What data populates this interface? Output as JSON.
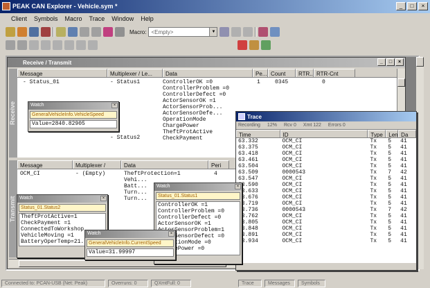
{
  "app": {
    "title": "PEAK CAN Explorer - Vehicle.sym *"
  },
  "menu": [
    "Client",
    "Symbols",
    "Macro",
    "Trace",
    "Window",
    "Help"
  ],
  "toolbar": {
    "macro_label": "Macro:",
    "macro_value": "<Empty>"
  },
  "receive": {
    "title": "Receive / Transmit",
    "tab_label": "Receive",
    "headers": [
      "Message",
      "Multiplexer / Le...",
      "Data",
      "Pe...",
      "Count",
      "RTR...",
      "RTR-Cnt"
    ],
    "message": "- Status_01",
    "mux1": "- Status1",
    "mux2": "- Status2",
    "period": "1",
    "count": "0345",
    "rtr_cnt": "0",
    "signals": [
      "ControllerOK      =0",
      "ControllerProblem =0",
      "ControllerDefect  =0",
      "ActorSensorOK     =1",
      "ActorSensorProb...",
      "ActorSensorDefe...",
      "OperationMode",
      "ChargePower",
      "TheftProtActive",
      "CheckPayment"
    ]
  },
  "transmit": {
    "tab_label": "Transmit",
    "headers": [
      "Message",
      "Multiplexer /",
      "Data",
      "Peri"
    ],
    "message": "OCM_CI",
    "mux": "- (Empty)",
    "signals": [
      "TheftProtection=1",
      "Vehi...",
      "Batt...",
      "Turn...",
      "Turn..."
    ],
    "period": "4"
  },
  "watch1": {
    "title": "Watch",
    "selector": "GeneralVehicleInfo.VehicleSpeed",
    "value": "Value=2840.82905"
  },
  "watch2": {
    "title": "Watch",
    "selector": "Status_01.Status2",
    "rows": [
      "TheftProtActive=1",
      "CheckPayment    =1",
      "ConnectedToWorkshop",
      "VehicleMoving   =1",
      "BatteryOperTemp=21..."
    ]
  },
  "watch3": {
    "title": "Watch",
    "selector": "GeneralVehicleInfo.CurrentSpeed",
    "value": "Value=31.99997"
  },
  "watch4": {
    "title": "Watch",
    "selector": "Status_01.Status1",
    "rows": [
      "ControllerOK      =1",
      "ControllerProblem =0",
      "ControllerDefect  =0",
      "ActorSensorOK     =1",
      "ActorSensorProblem=1",
      "ActorSensorDefect =0",
      "OperationMode     =0",
      "ChargePower       =0"
    ]
  },
  "trace": {
    "title": "Trace",
    "status": [
      "Recording",
      "12%",
      "Rcv 0",
      "Xmt 122",
      "Errors 0"
    ],
    "headers": [
      "Time",
      "ID",
      "Type",
      "Len",
      "Da"
    ],
    "rows": [
      [
        "63.332",
        "OCM_CI",
        "Tx",
        "5",
        "41"
      ],
      [
        "63.375",
        "OCM_CI",
        "Tx",
        "5",
        "41"
      ],
      [
        "63.418",
        "OCM_CI",
        "Tx",
        "5",
        "41"
      ],
      [
        "63.461",
        "OCM_CI",
        "Tx",
        "5",
        "41"
      ],
      [
        "63.504",
        "OCM_CI",
        "Tx",
        "5",
        "41"
      ],
      [
        "63.509",
        "0000543",
        "Tx",
        "7",
        "42"
      ],
      [
        "63.547",
        "OCM_CI",
        "Tx",
        "5",
        "41"
      ],
      [
        "63.590",
        "OCM_CI",
        "Tx",
        "5",
        "41"
      ],
      [
        "63.633",
        "OCM_CI",
        "Tx",
        "5",
        "41"
      ],
      [
        "63.676",
        "OCM_CI",
        "Tx",
        "5",
        "41"
      ],
      [
        "63.719",
        "OCM_CI",
        "Tx",
        "5",
        "41"
      ],
      [
        "63.736",
        "0000543",
        "Tx",
        "7",
        "42"
      ],
      [
        "63.762",
        "OCM_CI",
        "Tx",
        "5",
        "41"
      ],
      [
        "63.805",
        "OCM_CI",
        "Tx",
        "5",
        "41"
      ],
      [
        "63.848",
        "OCM_CI",
        "Tx",
        "5",
        "41"
      ],
      [
        "63.891",
        "OCM_CI",
        "Tx",
        "5",
        "41"
      ],
      [
        "63.934",
        "OCM_CI",
        "Tx",
        "5",
        "41"
      ]
    ]
  },
  "statusbar": [
    "Connected to: PCAN-USB (Net: Peak)",
    "Overruns: 0",
    "QXmtFull: 0",
    "Trace",
    "Messages",
    "Symbols"
  ]
}
